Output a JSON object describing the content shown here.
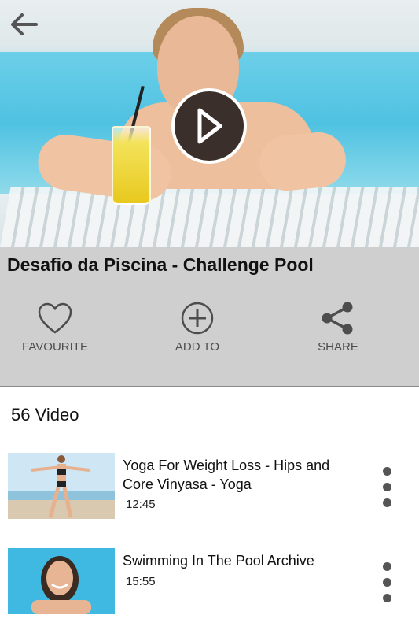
{
  "hero": {
    "back_icon": "arrow-left-icon",
    "play_icon": "play-icon"
  },
  "video": {
    "title": "Desafio da Piscina - Challenge Pool"
  },
  "actions": [
    {
      "label": "FAVOURITE",
      "icon": "heart-outline-icon"
    },
    {
      "label": "ADD TO",
      "icon": "plus-circle-icon"
    },
    {
      "label": "SHARE",
      "icon": "share-icon"
    }
  ],
  "list": {
    "count_label": "56 Video",
    "items": [
      {
        "title": "Yoga For Weight Loss - Hips and Core Vinyasa - Yoga",
        "duration": "12:45"
      },
      {
        "title": "Swimming In The Pool Archive",
        "duration": "15:55"
      }
    ]
  },
  "colors": {
    "action_bar_bg": "#cfcfcf",
    "play_button_bg": "#3a2f2a",
    "text": "#111111",
    "label": "#4d4d4d"
  }
}
